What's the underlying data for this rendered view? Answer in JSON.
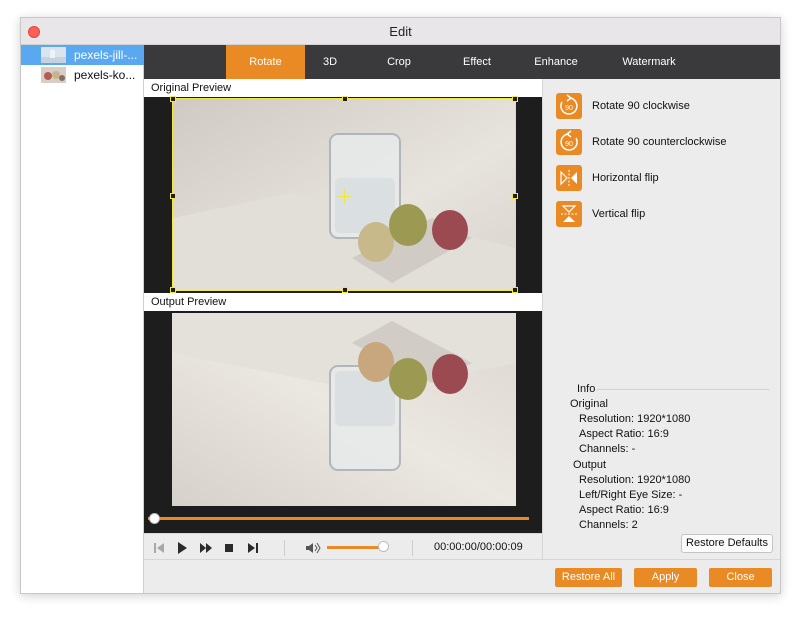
{
  "window": {
    "title": "Edit"
  },
  "files": [
    {
      "label": "pexels-jill-...",
      "selected": true
    },
    {
      "label": "pexels-ko...",
      "selected": false
    }
  ],
  "tabs": [
    "Rotate",
    "3D",
    "Crop",
    "Effect",
    "Enhance",
    "Watermark"
  ],
  "active_tab": "Rotate",
  "previews": {
    "original_label": "Original Preview",
    "output_label": "Output Preview"
  },
  "player": {
    "timecode": "00:00:00/00:00:09",
    "timeline_progress": 0.0,
    "volume_level": 0.75
  },
  "rotate_options": [
    {
      "label": "Rotate 90 clockwise",
      "icon": "rotate-cw-icon",
      "badge": "90"
    },
    {
      "label": "Rotate 90 counterclockwise",
      "icon": "rotate-ccw-icon",
      "badge": "90"
    },
    {
      "label": "Horizontal flip",
      "icon": "horizontal-flip-icon"
    },
    {
      "label": "Vertical flip",
      "icon": "vertical-flip-icon"
    }
  ],
  "info": {
    "title": "Info",
    "original_heading": "Original",
    "original": {
      "resolution": "Resolution: 1920*1080",
      "aspect": "Aspect Ratio: 16:9",
      "channels": "Channels: -"
    },
    "output_heading": "Output",
    "output": {
      "resolution": "Resolution: 1920*1080",
      "eye_size": "Left/Right Eye Size: -",
      "aspect": "Aspect Ratio: 16:9",
      "channels": "Channels: 2"
    }
  },
  "buttons": {
    "restore_defaults": "Restore Defaults",
    "restore_all": "Restore All",
    "apply": "Apply",
    "close": "Close"
  },
  "colors": {
    "accent": "#e98a25",
    "selection": "#5aa8f0",
    "tabbar": "#3a3a3c",
    "crop_outline": "#f2e640"
  }
}
